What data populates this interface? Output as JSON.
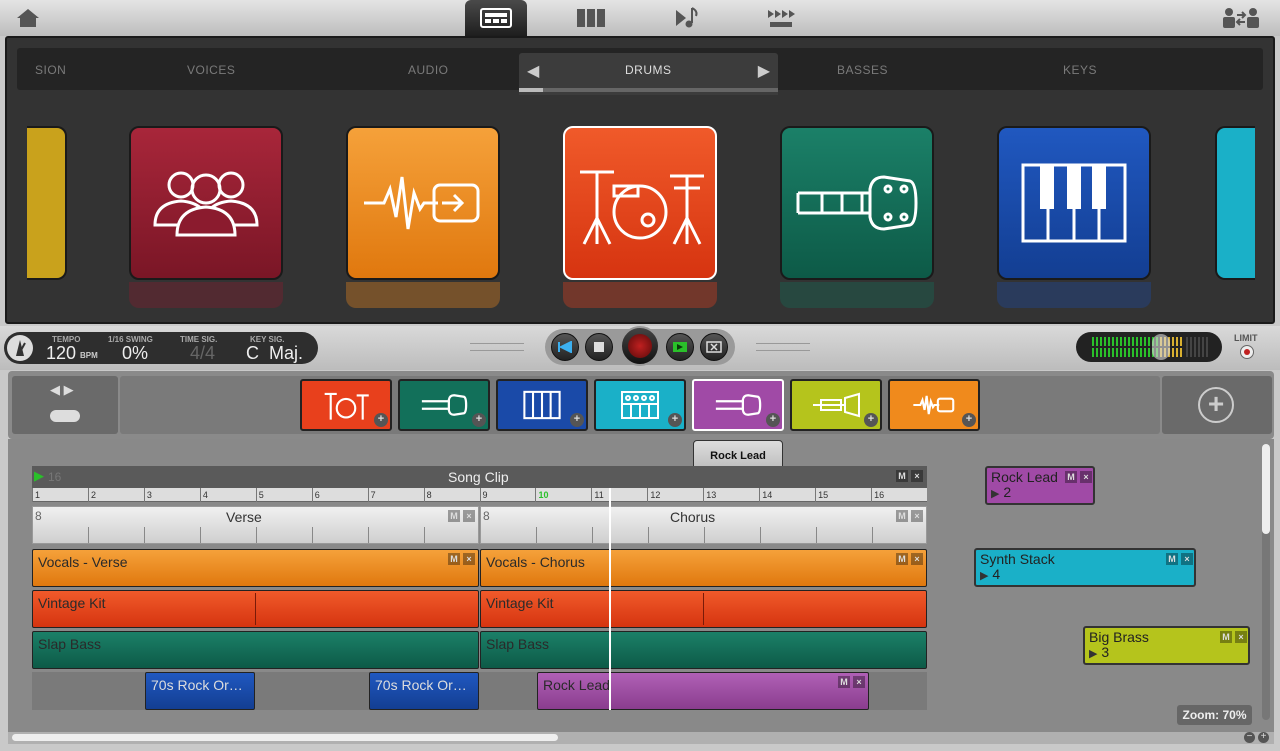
{
  "nav": {
    "home": "home-icon",
    "tabs": [
      "browser-icon",
      "mixer-icon",
      "composer-icon",
      "loops-icon"
    ],
    "share": "share-icon"
  },
  "categories": {
    "items": [
      "SION",
      "VOICES",
      "AUDIO",
      "DRUMS",
      "BASSES",
      "KEYS"
    ],
    "selected": "DRUMS"
  },
  "tiles": [
    {
      "name": "voices",
      "color": "#8b1b2e"
    },
    {
      "name": "audio",
      "color": "#f08a1c"
    },
    {
      "name": "drums",
      "color": "#e8401c"
    },
    {
      "name": "basses",
      "color": "#12705a"
    },
    {
      "name": "keys",
      "color": "#1a4aa8"
    }
  ],
  "transport": {
    "tempo_label": "TEMPO",
    "tempo_value": "120",
    "tempo_unit": "BPM",
    "swing_label": "1/16 SWING",
    "swing_value": "0%",
    "timesig_label": "TIME SIG.",
    "timesig_value": "4/4",
    "keysig_label": "KEY SIG.",
    "keysig_value": "C  Maj.",
    "limit_label": "LIMIT"
  },
  "instruments": [
    {
      "name": "drums",
      "color": "#e8401c"
    },
    {
      "name": "bass",
      "color": "#12705a"
    },
    {
      "name": "keys",
      "color": "#1a4aa8"
    },
    {
      "name": "synth",
      "color": "#1ab0c8"
    },
    {
      "name": "guitar",
      "color": "#8a3d8e"
    },
    {
      "name": "brass",
      "color": "#b5c41c"
    },
    {
      "name": "audio",
      "color": "#f08a1c"
    }
  ],
  "tooltip": "Rock Lead",
  "song": {
    "title": "Song Clip",
    "loop_value": "16",
    "bars": [
      "1",
      "2",
      "3",
      "4",
      "5",
      "6",
      "7",
      "8",
      "9",
      "10",
      "11",
      "12",
      "13",
      "14",
      "15",
      "16"
    ],
    "current_bar": "10"
  },
  "sections": [
    {
      "len": "8",
      "name": "Verse"
    },
    {
      "len": "8",
      "name": "Chorus"
    }
  ],
  "clips": {
    "vocals_verse": "Vocals - Verse",
    "vocals_chorus": "Vocals - Chorus",
    "vintage1": "Vintage Kit",
    "vintage2": "Vintage Kit",
    "slap1": "Slap Bass",
    "slap2": "Slap Bass",
    "rock_or1": "70s Rock Or…",
    "rock_or2": "70s Rock Or…",
    "rock_lead": "Rock Lead"
  },
  "free_clips": [
    {
      "name": "Rock Lead",
      "count": "2",
      "color": "#a04aa6"
    },
    {
      "name": "Synth Stack",
      "count": "4",
      "color": "#1ab0c8"
    },
    {
      "name": "Big Brass",
      "count": "3",
      "color": "#b5c41c"
    }
  ],
  "mute_label": "M",
  "remove_label": "×",
  "zoom": "Zoom: 70%"
}
